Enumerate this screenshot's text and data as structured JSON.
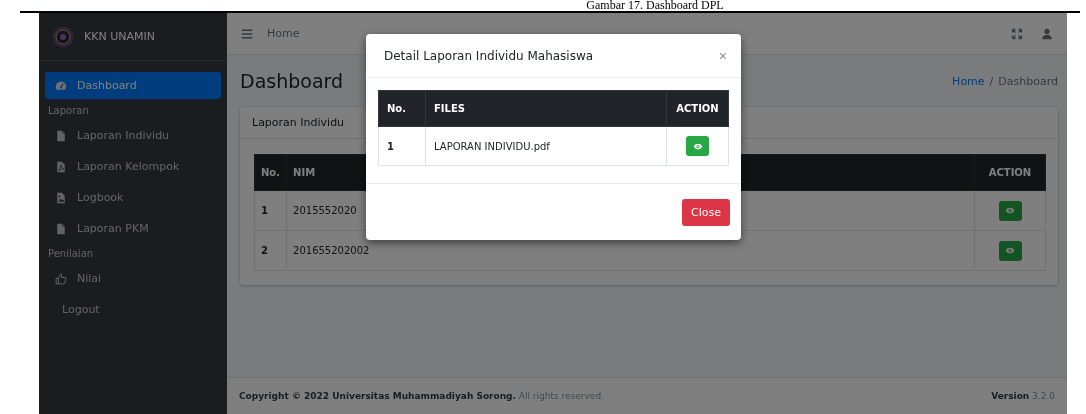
{
  "caption": "Gambar 17. Dashboard DPL",
  "sidebar": {
    "brand": "KKN UNAMIN",
    "items": [
      {
        "kind": "link",
        "label": "Dashboard",
        "selected": true
      },
      {
        "kind": "header",
        "label": "Laporan"
      },
      {
        "kind": "link",
        "label": "Laporan Individu",
        "selected": false
      },
      {
        "kind": "link",
        "label": "Laporan Kelompok",
        "selected": false
      },
      {
        "kind": "link",
        "label": "Logbook",
        "selected": false
      },
      {
        "kind": "link",
        "label": "Laporan PKM",
        "selected": false
      },
      {
        "kind": "header",
        "label": "Penilaian"
      },
      {
        "kind": "link",
        "label": "Nilai",
        "selected": false
      },
      {
        "kind": "link",
        "label": "Logout",
        "selected": false
      }
    ]
  },
  "navbar": {
    "home_link": "Home"
  },
  "page_title": "Dashboard",
  "breadcrumb": [
    {
      "label": "Home",
      "kind": "link"
    },
    {
      "label": "/",
      "kind": "separator"
    },
    {
      "label": "Dashboard",
      "kind": "current"
    }
  ],
  "card": {
    "title": "Laporan Individu",
    "columns": [
      "No.",
      "NIM",
      "ACTION"
    ],
    "rows": [
      {
        "no": "1",
        "nim": "2015552020"
      },
      {
        "no": "2",
        "nim": "201655202002"
      }
    ]
  },
  "footer": {
    "copyright": "**Copyright © 2022 Universitas Muhammadiyah Sorong.** All rights reserved.",
    "version": "**Version** 3.2.0"
  },
  "modal": {
    "title": "Detail Laporan Individu Mahasiswa",
    "close_icon": "×",
    "columns": [
      "No.",
      "FILES",
      "ACTION"
    ],
    "rows": [
      {
        "no": "1",
        "file": "LAPORAN INDIVIDU.pdf"
      }
    ],
    "close_button": "Close"
  }
}
